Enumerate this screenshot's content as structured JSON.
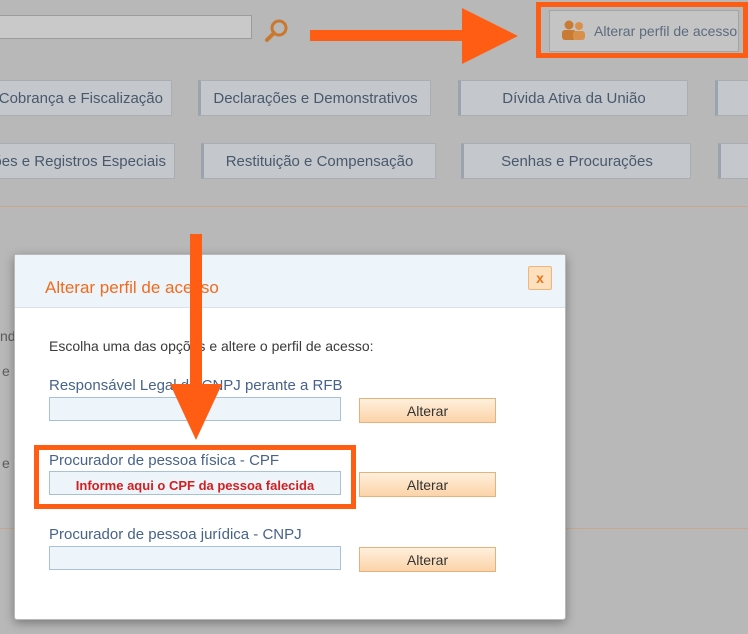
{
  "header": {
    "profile_button_label": "Alterar perfil de acesso",
    "icons": {
      "search": "magnifier-icon",
      "profile": "users-icon"
    }
  },
  "menu": {
    "row1": [
      "Cobrança e Fiscalização",
      "Declarações e Demonstrativos",
      "Dívida Ativa da União"
    ],
    "row2": [
      "Legislações e Registros Especiais",
      "Restituição e Compensação",
      "Senhas e Procurações"
    ]
  },
  "background_fragments": [
    "nd",
    "e",
    "e"
  ],
  "dialog": {
    "title": "Alterar perfil de acesso",
    "close_label": "x",
    "instructions": "Escolha uma das opções e altere o perfil de acesso:",
    "options": [
      {
        "label": "Responsável Legal do CNPJ perante a RFB",
        "value": "",
        "button": "Alterar"
      },
      {
        "label": "Procurador de pessoa física - CPF",
        "value": "",
        "button": "Alterar"
      },
      {
        "label": "Procurador de pessoa jurídica - CNPJ",
        "value": "",
        "button": "Alterar"
      }
    ]
  },
  "annotations": {
    "cpf_hint": "Informe aqui o CPF da pessoa falecida",
    "color": "#ff5d13"
  }
}
